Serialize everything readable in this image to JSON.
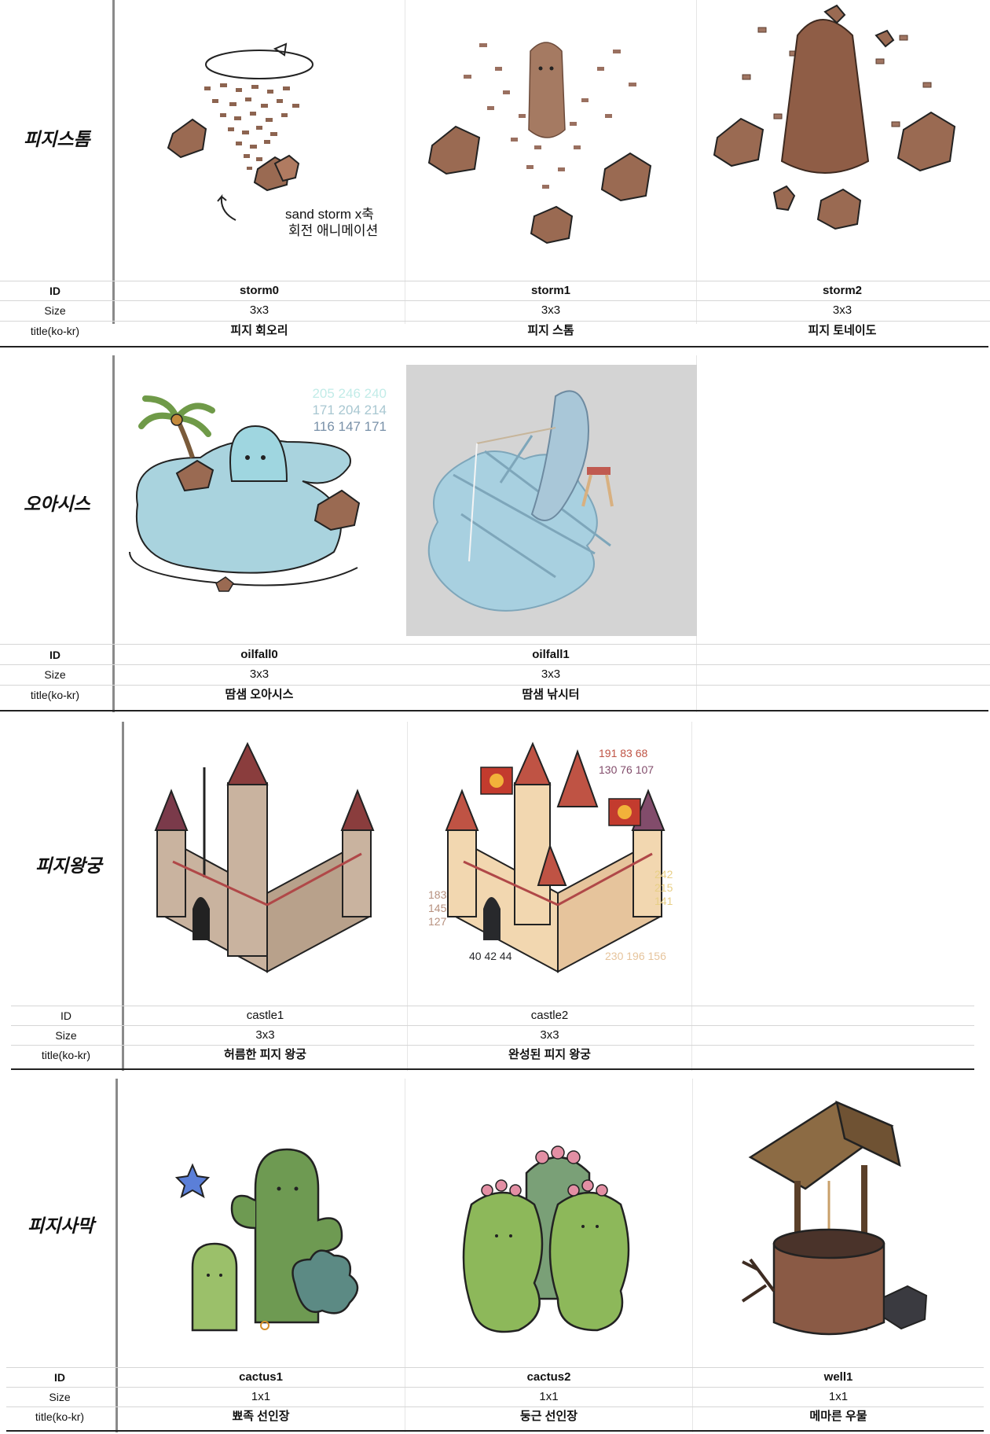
{
  "row_labels": {
    "id": "ID",
    "size": "Size",
    "title": "title(ko-kr)"
  },
  "sections": [
    {
      "name": "피지스톰",
      "items": [
        {
          "id": "storm0",
          "size": "3x3",
          "title": "피지 회오리"
        },
        {
          "id": "storm1",
          "size": "3x3",
          "title": "피지 스톰"
        },
        {
          "id": "storm2",
          "size": "3x3",
          "title": "피지 토네이도"
        }
      ],
      "note_line1": "sand storm x축",
      "note_line2": "회전 애니메이션"
    },
    {
      "name": "오아시스",
      "items": [
        {
          "id": "oilfall0",
          "size": "3x3",
          "title": "땀샘 오아시스"
        },
        {
          "id": "oilfall1",
          "size": "3x3",
          "title": "땀샘 낚시터"
        }
      ],
      "color_codes": [
        "205 246 240",
        "171 204 214",
        "116 147 171"
      ]
    },
    {
      "name": "피지왕궁",
      "items": [
        {
          "id": "castle1",
          "size": "3x3",
          "title": "허름한 피지 왕궁"
        },
        {
          "id": "castle2",
          "size": "3x3",
          "title": "완성된 피지 왕궁"
        }
      ],
      "color_codes": {
        "roof_top": "191 83 68",
        "roof_bottom": "130 76 107",
        "right_1": "242",
        "right_2": "215",
        "right_3": "141",
        "left_1": "183",
        "left_2": "145",
        "left_3": "127",
        "dark": "40 42 44",
        "base": "230 196 156"
      }
    },
    {
      "name": "피지사막",
      "items": [
        {
          "id": "cactus1",
          "size": "1x1",
          "title": "뾰족 선인장"
        },
        {
          "id": "cactus2",
          "size": "1x1",
          "title": "둥근 선인장"
        },
        {
          "id": "well1",
          "size": "1x1",
          "title": "메마른 우물"
        }
      ]
    }
  ],
  "colors": {
    "rock": "#9a6a52",
    "water": "#a9d3de",
    "castle_wall": "#c9b39f",
    "roof": "#b0504a",
    "cactus": "#7aa04d"
  }
}
